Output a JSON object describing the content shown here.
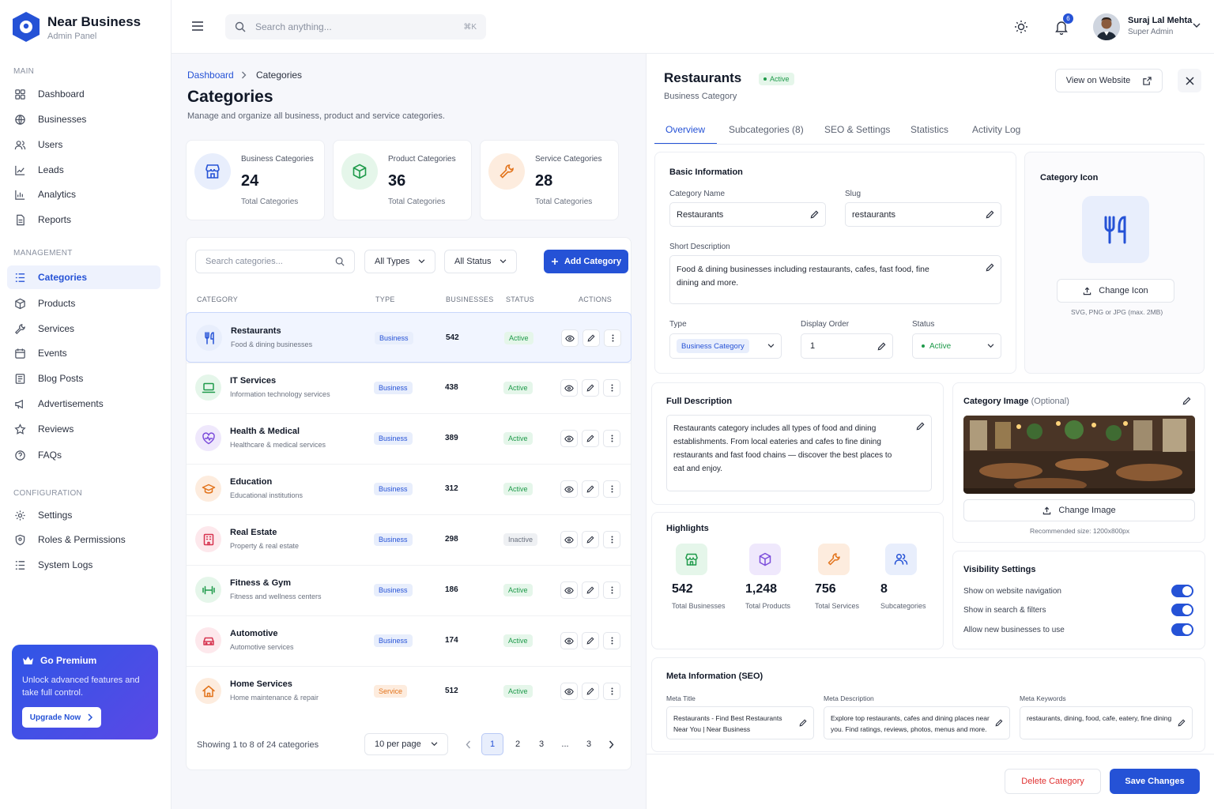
{
  "brand": {
    "title": "Near Business",
    "subtitle": "Admin Panel"
  },
  "sidebar": {
    "sections": [
      {
        "label": "MAIN",
        "items": [
          "Dashboard",
          "Businesses",
          "Users",
          "Leads",
          "Analytics",
          "Reports"
        ]
      },
      {
        "label": "MANAGEMENT",
        "items": [
          "Categories",
          "Products",
          "Services",
          "Events",
          "Blog Posts",
          "Advertisements",
          "Reviews",
          "FAQs"
        ]
      },
      {
        "label": "CONFIGURATION",
        "items": [
          "Settings",
          "Roles & Permissions",
          "System Logs"
        ]
      }
    ],
    "active_item": "Categories",
    "premium": {
      "title": "Go Premium",
      "text": "Unlock advanced features and take full control.",
      "button": "Upgrade Now"
    }
  },
  "topbar": {
    "search_placeholder": "Search anything...",
    "shortcut": "⌘K",
    "notification_count": "6",
    "user": {
      "name": "Suraj Lal Mehta",
      "role": "Super Admin"
    }
  },
  "page": {
    "breadcrumb": [
      "Dashboard",
      "Categories"
    ],
    "title": "Categories",
    "subtitle": "Manage and organize all business, product and service categories."
  },
  "stats": [
    {
      "label": "Business Categories",
      "value": "24",
      "foot": "Total Categories",
      "color": "#2552d6",
      "icon": "store-icon"
    },
    {
      "label": "Product Categories",
      "value": "36",
      "foot": "Total Categories",
      "color": "#1e9a4a",
      "icon": "cube-icon"
    },
    {
      "label": "Service Categories",
      "value": "28",
      "foot": "Total Categories",
      "color": "#e2731b",
      "icon": "wrench-icon"
    }
  ],
  "filters": {
    "search_placeholder": "Search categories...",
    "type": "All Types",
    "status": "All Status",
    "add_button": "Add Category"
  },
  "table": {
    "headers": [
      "CATEGORY",
      "TYPE",
      "BUSINESSES",
      "STATUS",
      "ACTIONS"
    ],
    "rows": [
      {
        "name": "Restaurants",
        "desc": "Food & dining businesses",
        "type": "Business",
        "count": "542",
        "status": "Active",
        "icon": "utensils-icon"
      },
      {
        "name": "IT Services",
        "desc": "Information technology services",
        "type": "Business",
        "count": "438",
        "status": "Active",
        "icon": "laptop-icon"
      },
      {
        "name": "Health & Medical",
        "desc": "Healthcare & medical services",
        "type": "Business",
        "count": "389",
        "status": "Active",
        "icon": "heart-pulse-icon"
      },
      {
        "name": "Education",
        "desc": "Educational institutions",
        "type": "Business",
        "count": "312",
        "status": "Active",
        "icon": "graduation-cap-icon"
      },
      {
        "name": "Real Estate",
        "desc": "Property & real estate",
        "type": "Business",
        "count": "298",
        "status": "Inactive",
        "icon": "building-icon"
      },
      {
        "name": "Fitness & Gym",
        "desc": "Fitness and wellness centers",
        "type": "Business",
        "count": "186",
        "status": "Active",
        "icon": "dumbbell-icon"
      },
      {
        "name": "Automotive",
        "desc": "Automotive services",
        "type": "Business",
        "count": "174",
        "status": "Active",
        "icon": "car-icon"
      },
      {
        "name": "Home Services",
        "desc": "Home maintenance & repair",
        "type": "Service",
        "count": "512",
        "status": "Active",
        "icon": "house-icon"
      }
    ],
    "showing": "Showing 1 to 8 of 24 categories",
    "per_page": "10 per page",
    "pages": [
      "1",
      "2",
      "3",
      "...",
      "3"
    ]
  },
  "drawer": {
    "title": "Restaurants",
    "status": "Active",
    "subtitle": "Business Category",
    "view_button": "View on Website",
    "tabs": [
      "Overview",
      "Subcategories (8)",
      "SEO & Settings",
      "Statistics",
      "Activity Log"
    ],
    "basic": {
      "title": "Basic Information",
      "name_label": "Category Name",
      "name_value": "Restaurants",
      "slug_label": "Slug",
      "slug_value": "restaurants",
      "short_label": "Short Description",
      "short_value": "Food & dining businesses including restaurants, cafes, fast food, fine dining and more.",
      "type_label": "Type",
      "type_value": "Business Category",
      "order_label": "Display Order",
      "order_value": "1",
      "status_label": "Status",
      "status_value": "Active"
    },
    "icon_panel": {
      "title": "Category Icon",
      "button": "Change Icon",
      "hint": "SVG, PNG or JPG (max. 2MB)"
    },
    "full_desc": {
      "title": "Full Description",
      "text": "Restaurants category includes all types of food and dining establishments. From local eateries and cafes to fine dining restaurants and fast food chains — discover the best places to eat and enjoy."
    },
    "image_panel": {
      "title": "Category Image",
      "optional": "(Optional)",
      "button": "Change Image",
      "hint": "Recommended size: 1200x800px"
    },
    "highlights": {
      "title": "Highlights",
      "items": [
        {
          "value": "542",
          "label": "Total Businesses",
          "color": "#1e9a4a",
          "bg": "#e5f6ea",
          "icon": "store-icon"
        },
        {
          "value": "1,248",
          "label": "Total Products",
          "color": "#7c4ddb",
          "bg": "#efe8fc",
          "icon": "cube-icon"
        },
        {
          "value": "756",
          "label": "Total Services",
          "color": "#e2731b",
          "bg": "#fdecde",
          "icon": "wrench-icon"
        },
        {
          "value": "8",
          "label": "Subcategories",
          "color": "#2552d6",
          "bg": "#e8eefc",
          "icon": "users-icon"
        }
      ]
    },
    "visibility": {
      "title": "Visibility Settings",
      "items": [
        {
          "label": "Show on website navigation",
          "on": true
        },
        {
          "label": "Show in search & filters",
          "on": true
        },
        {
          "label": "Allow new businesses to use",
          "on": true
        }
      ]
    },
    "seo": {
      "title": "Meta Information (SEO)",
      "meta_title_label": "Meta Title",
      "meta_title": "Restaurants - Find Best Restaurants Near You | Near Business",
      "meta_desc_label": "Meta Description",
      "meta_desc": "Explore top restaurants, cafes and dining places near you. Find ratings, reviews, photos, menus and more.",
      "meta_kw_label": "Meta Keywords",
      "meta_kw": "restaurants, dining, food, cafe, eatery, fine dining"
    },
    "delete_button": "Delete Category",
    "save_button": "Save Changes"
  }
}
